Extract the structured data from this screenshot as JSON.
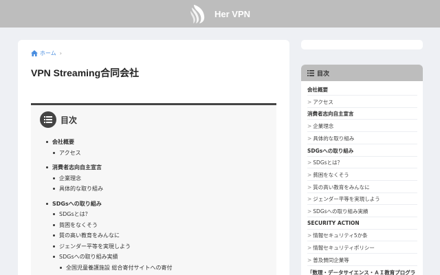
{
  "header": {
    "site_name": "Her VPN",
    "logo_icon": "feather-hair-logo-icon"
  },
  "breadcrumb": {
    "home_label": "ホーム",
    "separator": "›"
  },
  "page": {
    "title": "VPN Streaming合同会社"
  },
  "toc": {
    "title": "目次",
    "items": [
      {
        "label": "会社概要",
        "level": 1
      },
      {
        "label": "アクセス",
        "level": 2
      },
      {
        "label": "消費者志向自主宣言",
        "level": 1
      },
      {
        "label": "企業理念",
        "level": 2
      },
      {
        "label": "具体的な取り組み",
        "level": 2
      },
      {
        "label": "SDGsへの取り組み",
        "level": 1
      },
      {
        "label": "SDGsとは？",
        "level": 2
      },
      {
        "label": "貧困をなくそう",
        "level": 2
      },
      {
        "label": "質の高い教育をみんなに",
        "level": 2
      },
      {
        "label": "ジェンダー平等を実現しよう",
        "level": 2
      },
      {
        "label": "SDGsへの取り組み実績",
        "level": 2
      },
      {
        "label": "全国児童養護施設 総合寄付サイトへの寄付",
        "level": 3
      }
    ]
  },
  "sidebar": {
    "toc_title": "目次",
    "chevron": ">",
    "items": [
      {
        "label": "会社概要",
        "bold": true
      },
      {
        "label": "アクセス",
        "bold": false
      },
      {
        "label": "消費者志向自主宣言",
        "bold": true
      },
      {
        "label": "企業理念",
        "bold": false
      },
      {
        "label": "具体的な取り組み",
        "bold": false
      },
      {
        "label": "SDGsへの取り組み",
        "bold": true
      },
      {
        "label": "SDGsとは？",
        "bold": false
      },
      {
        "label": "貧困をなくそう",
        "bold": false
      },
      {
        "label": "質の高い教育をみんなに",
        "bold": false
      },
      {
        "label": "ジェンダー平等を実現しよう",
        "bold": false
      },
      {
        "label": "SDGsへの取り組み実績",
        "bold": false
      },
      {
        "label": "SECURITY ACTION",
        "bold": true
      },
      {
        "label": "情報セキュリティ5か条",
        "bold": false
      },
      {
        "label": "情報セキュリティポリシー",
        "bold": false
      },
      {
        "label": "普及賛同企業等",
        "bold": false
      },
      {
        "label": "「数理・データサイエンス・ＡＩ教育プログラ",
        "bold": true
      }
    ]
  },
  "colors": {
    "header_bg": "#bdbdbd",
    "link": "#4a8ee0",
    "page_bg": "#eef0f4"
  }
}
